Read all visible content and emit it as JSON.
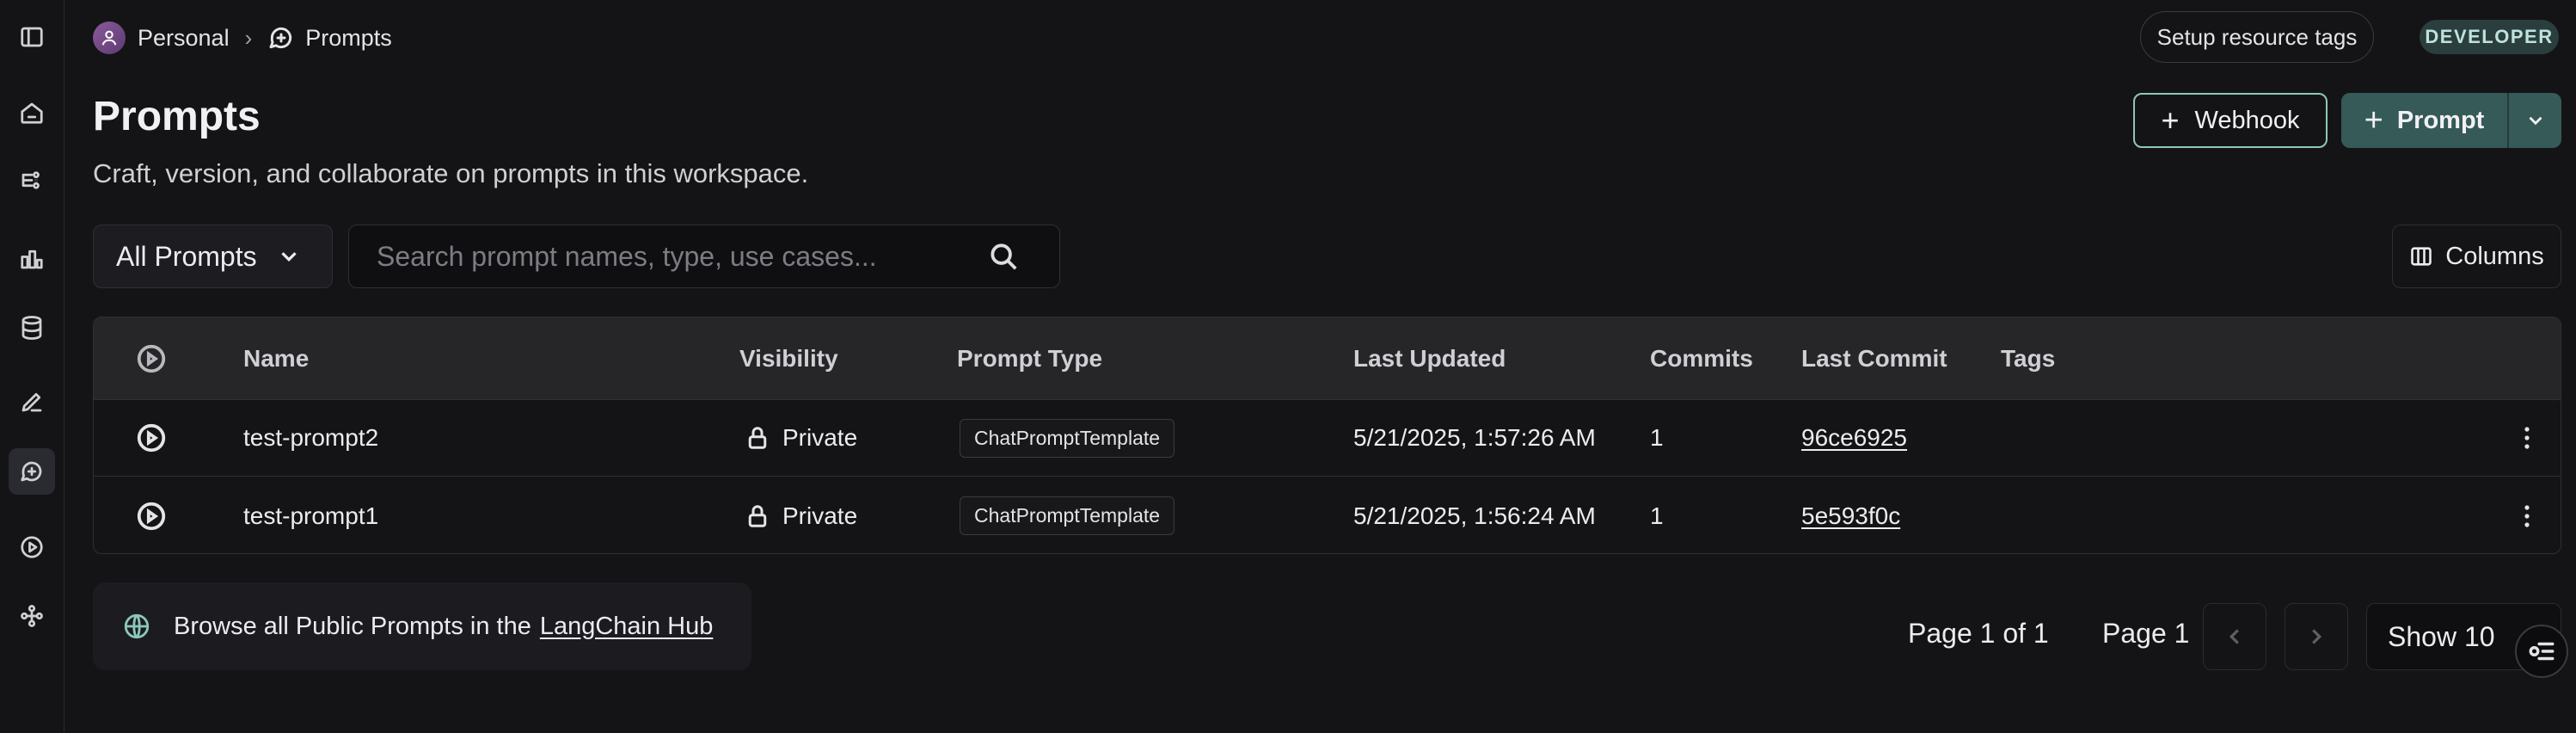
{
  "breadcrumb": {
    "workspace": "Personal",
    "separator": "›",
    "current": "Prompts"
  },
  "header": {
    "setup_tags_label": "Setup resource tags",
    "role_badge": "DEVELOPER"
  },
  "page": {
    "title": "Prompts",
    "subtitle": "Craft, version, and collaborate on prompts in this workspace."
  },
  "actions": {
    "webhook_label": "Webhook",
    "prompt_label": "Prompt"
  },
  "filters": {
    "scope_selected": "All Prompts",
    "search_placeholder": "Search prompt names, type, use cases...",
    "search_value": "",
    "columns_label": "Columns"
  },
  "table": {
    "headers": [
      "Name",
      "Visibility",
      "Prompt Type",
      "Last Updated",
      "Commits",
      "Last Commit",
      "Tags"
    ],
    "rows": [
      {
        "name": "test-prompt2",
        "visibility": "Private",
        "prompt_type": "ChatPromptTemplate",
        "last_updated": "5/21/2025, 1:57:26 AM",
        "commits": "1",
        "last_commit": "96ce6925",
        "tags": ""
      },
      {
        "name": "test-prompt1",
        "visibility": "Private",
        "prompt_type": "ChatPromptTemplate",
        "last_updated": "5/21/2025, 1:56:24 AM",
        "commits": "1",
        "last_commit": "5e593f0c",
        "tags": ""
      }
    ]
  },
  "hub": {
    "text": "Browse all Public Prompts in the",
    "link": "LangChain Hub"
  },
  "pagination": {
    "page_of": "Page 1 of 1",
    "page_label": "Page 1",
    "show_selected": "Show 10"
  },
  "colors": {
    "accent": "#355a58",
    "accent_border": "#8cc8bc",
    "background": "#141416"
  },
  "sidebar": {
    "icons": [
      "sidebar-toggle-icon",
      "home-icon",
      "tracing-icon",
      "monitoring-icon",
      "datasets-icon",
      "annotation-icon",
      "prompts-icon",
      "playground-icon",
      "deployments-icon"
    ],
    "active": "prompts-icon"
  }
}
